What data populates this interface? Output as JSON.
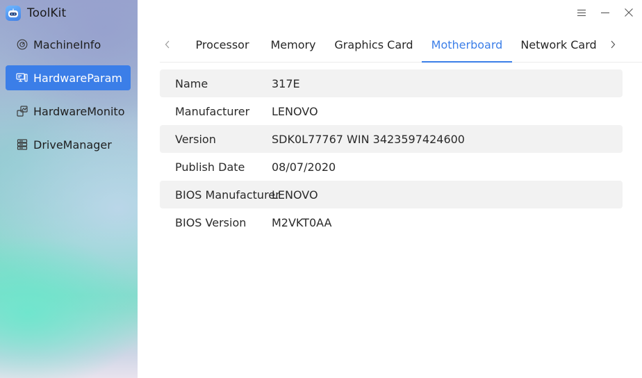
{
  "app": {
    "title": "ToolKit",
    "logo_icon": "robot-logo-icon",
    "accent_color": "#3b7ee8"
  },
  "sidebar": {
    "items": [
      {
        "label": "MachineInfo",
        "icon": "gauge-icon",
        "active": false
      },
      {
        "label": "HardwareParam",
        "icon": "monitor-param-icon",
        "active": true
      },
      {
        "label": "HardwareMonito",
        "icon": "hardware-monitor-icon",
        "active": false
      },
      {
        "label": "DriveManager",
        "icon": "drive-stack-icon",
        "active": false
      }
    ]
  },
  "window_controls": {
    "menu_icon": "menu-icon",
    "minimize_icon": "minimize-icon",
    "close_icon": "close-icon"
  },
  "tabs": {
    "prev_icon": "chevron-left-icon",
    "next_icon": "chevron-right-icon",
    "items": [
      {
        "label": "Processor",
        "active": false
      },
      {
        "label": "Memory",
        "active": false
      },
      {
        "label": "Graphics Card",
        "active": false
      },
      {
        "label": "Motherboard",
        "active": true
      },
      {
        "label": "Network Card",
        "active": false
      }
    ]
  },
  "properties": [
    {
      "label": "Name",
      "value": "317E"
    },
    {
      "label": "Manufacturer",
      "value": "LENOVO"
    },
    {
      "label": "Version",
      "value": "SDK0L77767 WIN 3423597424600"
    },
    {
      "label": "Publish Date",
      "value": "08/07/2020"
    },
    {
      "label": "BIOS Manufacturer",
      "value": "LENOVO"
    },
    {
      "label": "BIOS Version",
      "value": "M2VKT0AA"
    }
  ]
}
